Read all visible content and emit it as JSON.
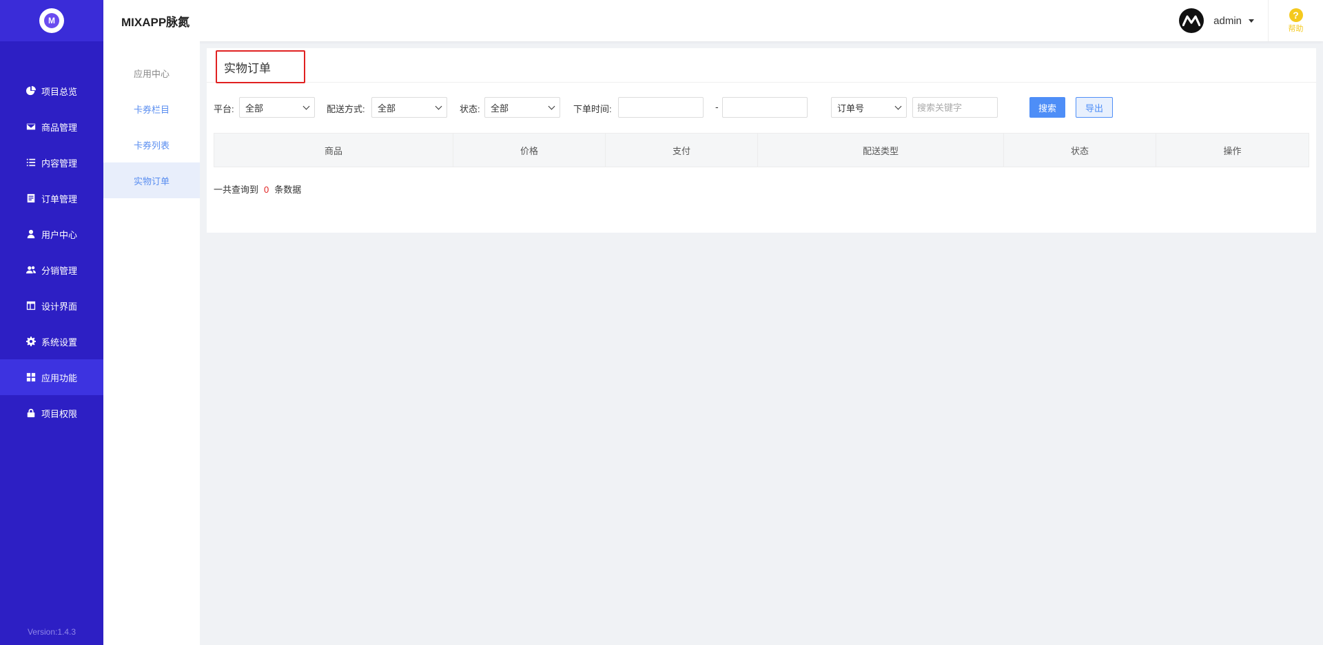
{
  "app": {
    "title": "MIXAPP脉氮",
    "version": "Version:1.4.3"
  },
  "sidebar": {
    "items": [
      {
        "label": "项目总览",
        "icon": "pie-chart-icon"
      },
      {
        "label": "商品管理",
        "icon": "envelope-icon"
      },
      {
        "label": "内容管理",
        "icon": "list-icon"
      },
      {
        "label": "订单管理",
        "icon": "document-icon"
      },
      {
        "label": "用户中心",
        "icon": "user-icon"
      },
      {
        "label": "分销管理",
        "icon": "users-icon"
      },
      {
        "label": "设计界面",
        "icon": "layout-icon"
      },
      {
        "label": "系统设置",
        "icon": "gear-icon"
      },
      {
        "label": "应用功能",
        "icon": "grid-icon",
        "active": true
      },
      {
        "label": "项目权限",
        "icon": "lock-icon"
      }
    ]
  },
  "subsidebar": {
    "items": [
      {
        "label": "应用中心"
      },
      {
        "label": "卡券栏目"
      },
      {
        "label": "卡券列表"
      },
      {
        "label": "实物订单",
        "active": true
      }
    ]
  },
  "header": {
    "user": "admin",
    "help_label": "帮助",
    "help_glyph": "?"
  },
  "page": {
    "title": "实物订单"
  },
  "filters": {
    "platform_label": "平台:",
    "platform_value": "全部",
    "delivery_label": "配送方式:",
    "delivery_value": "全部",
    "status_label": "状态:",
    "status_value": "全部",
    "time_label": "下单时间:",
    "time_dash": "-",
    "field_value": "订单号",
    "keyword_placeholder": "搜索关键字",
    "search_label": "搜索",
    "export_label": "导出"
  },
  "table": {
    "columns": [
      "商品",
      "价格",
      "支付",
      "配送类型",
      "状态",
      "操作"
    ]
  },
  "summary": {
    "prefix": "一共查询到",
    "count": "0",
    "suffix": "条数据"
  },
  "colors": {
    "sidebar_bg": "#2d1fc4",
    "active_item": "#3d33e0",
    "accent_blue": "#4e8ef7",
    "highlight_red": "#e02020",
    "help_yellow": "#f4c91e"
  }
}
